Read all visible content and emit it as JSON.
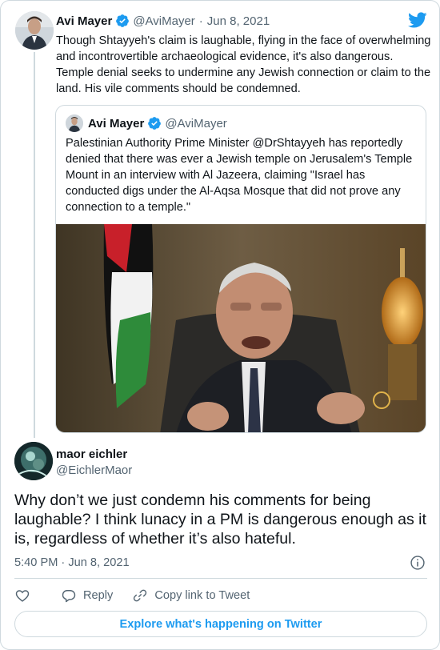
{
  "colors": {
    "accent": "#1d9bf0",
    "text": "#0f1419",
    "muted": "#536471",
    "border": "#cfd9de"
  },
  "parent_tweet": {
    "author_name": "Avi Mayer",
    "handle": "@AviMayer",
    "separator": "·",
    "date": "Jun 8, 2021",
    "text": "Though Shtayyeh's claim is laughable, flying in the face of overwhelming and incontrovertible archaeological evidence, it's also dangerous. Temple denial seeks to undermine any Jewish connection or claim to the land. His vile comments should be condemned.",
    "verified_icon": "verified-badge-icon",
    "logo_icon": "twitter-bird-icon"
  },
  "quoted_tweet": {
    "author_name": "Avi Mayer",
    "handle": "@AviMayer",
    "text": "Palestinian Authority Prime Minister @DrShtayyeh has reportedly denied that there was ever a Jewish temple on Jerusalem's Temple Mount in an interview with Al Jazeera, claiming \"Israel has conducted digs under the Al-Aqsa Mosque that did not prove any connection to a temple.\"",
    "media_icon": "video-still-image"
  },
  "reply": {
    "author_name": "maor eichler",
    "handle": "@EichlerMaor",
    "text": "Why don’t we just condemn his comments for being laughable? I think lunacy in a PM is dangerous enough as it is, regardless of whether it’s also hateful.",
    "timestamp": "5:40 PM · Jun 8, 2021"
  },
  "actions": {
    "like_icon": "heart-icon",
    "reply_label": "Reply",
    "copy_label": "Copy link to Tweet"
  },
  "footer": {
    "explore_label": "Explore what's happening on Twitter"
  }
}
